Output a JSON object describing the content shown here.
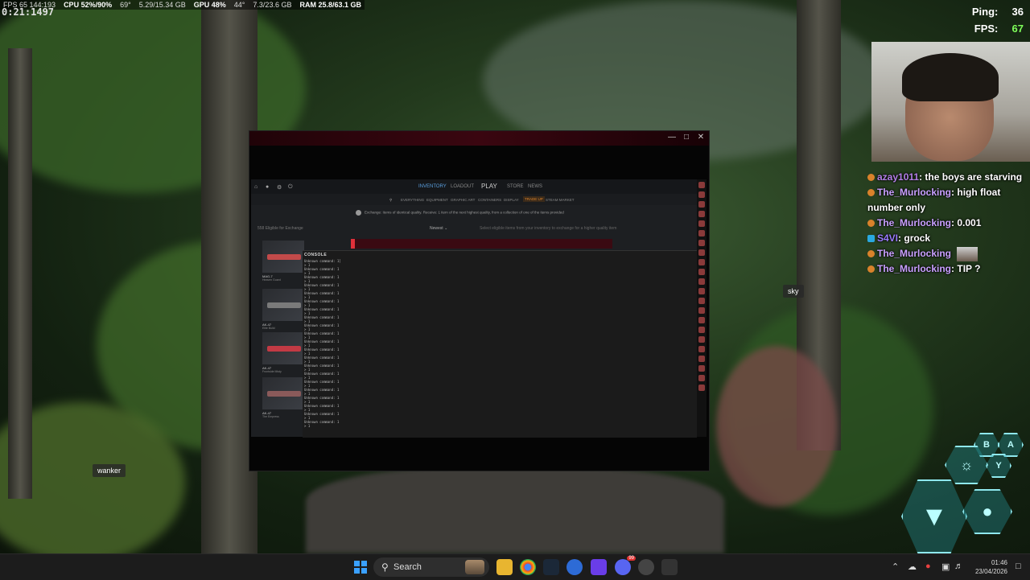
{
  "overlay": {
    "clock": "0:21:1497",
    "fps_line": "FPS 65  144:193",
    "cpu": "CPU 52%/90%",
    "cpu_temp": "69°",
    "cpu_mem": "5.29/15.34 GB",
    "gpu": "GPU 48%",
    "gpu_temp": "44°",
    "gpu_mem": "7.3/23.6 GB",
    "ram": "RAM 25.8/63.1 GB"
  },
  "stats": {
    "ping_label": "Ping:",
    "ping_value": "36",
    "fps_label": "FPS:",
    "fps_value": "67"
  },
  "chat": [
    {
      "user": "azay1011",
      "text": "the boys are starving"
    },
    {
      "user": "The_Murlocking",
      "text": "high float number only"
    },
    {
      "user": "The_Murlocking",
      "text": "0.001"
    },
    {
      "user": "S4VI",
      "text": "grock"
    },
    {
      "user": "The_Murlocking",
      "text": ""
    },
    {
      "user": "The_Murlocking",
      "text": "TIP ?"
    }
  ],
  "nametags": {
    "sky": "sky",
    "wanker": "wanker"
  },
  "hud": {
    "hex_a": "B",
    "hex_b": "A",
    "hex_c": "Y"
  },
  "game": {
    "nav": {
      "inventory": "INVENTORY",
      "loadout": "LOADOUT",
      "play": "PLAY",
      "store": "STORE",
      "news": "NEWS"
    },
    "subnav": {
      "everything": "EVERYTHING",
      "equipment": "EQUIPMENT",
      "graphic_art": "GRAPHIC ART",
      "containers": "CONTAINERS",
      "display": "DISPLAY",
      "trade_up": "TRADE UP",
      "steam_market": "STEAM MARKET"
    },
    "notice": "Exchange: Items of identical quality. Receive: 1 item of the next highest quality, from a collection of one of the items provided",
    "sort_header": "558 Eligible for Exchange",
    "sort_value": "Newest",
    "hint": "Select eligible items from your inventory to exchange for a higher quality item",
    "cards": [
      {
        "name": "MAG-7",
        "sub": "Heaven Guard"
      },
      {
        "name": "AK-47",
        "sub": "Elite Build"
      },
      {
        "name": "AK-47",
        "sub": "Frontside Misty"
      },
      {
        "name": "AK-47",
        "sub": "The Empress"
      }
    ],
    "console": {
      "title": "CONSOLE",
      "lines": [
        "Unknown command: 1]",
        "> 1",
        "Unknown command: 1",
        "> 1",
        "Unknown command: 1",
        "> 1",
        "Unknown command: 1",
        "> 1",
        "Unknown command: 1",
        "> 1",
        "Unknown command: 1",
        "> 1",
        "Unknown command: 1",
        "> 1",
        "Unknown command: 1",
        "> 1",
        "Unknown command: 1",
        "> 1",
        "Unknown command: 1",
        "> 1",
        "Unknown command: 1",
        "> 1",
        "Unknown command: 1",
        "> 1",
        "Unknown command: 1",
        "> 1",
        "Unknown command: 1",
        "> 1",
        "Unknown command: 1",
        "> 1",
        "Unknown command: 1",
        "> 1",
        "Unknown command: 1",
        "> 1",
        "Unknown command: 1",
        "> 1",
        "Unknown command: 1",
        "> 1",
        "Unknown command: 1",
        "> 1",
        "Unknown command: 1",
        "> 1"
      ]
    }
  },
  "taskbar": {
    "search_label": "Search",
    "time": "01:46",
    "date": "23/04/2026",
    "discord_badge": "99"
  },
  "colors": {
    "accent": "#5aa0e0",
    "trade_active": "#d9802b",
    "fps_green": "#7fff5a",
    "chat_user": "#b47fe8"
  }
}
